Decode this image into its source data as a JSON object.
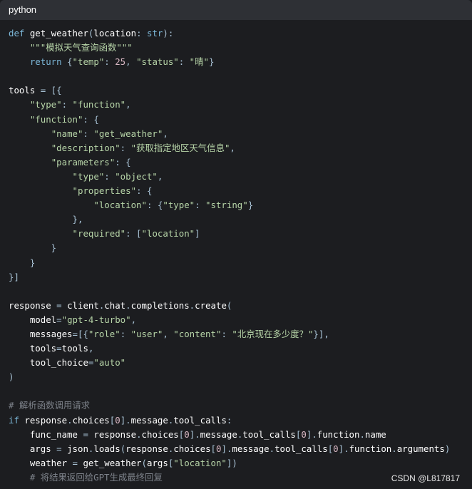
{
  "header": {
    "language": "python"
  },
  "code_lines": [
    [
      [
        "kw",
        "def "
      ],
      [
        "fn",
        "get_weather"
      ],
      [
        "pu",
        "("
      ],
      [
        "fn",
        "location"
      ],
      [
        "pu",
        ": "
      ],
      [
        "kw",
        "str"
      ],
      [
        "pu",
        "):"
      ]
    ],
    [
      [
        "pu",
        "    "
      ],
      [
        "str",
        "\"\"\"模拟天气查询函数\"\"\""
      ]
    ],
    [
      [
        "pu",
        "    "
      ],
      [
        "kw",
        "return "
      ],
      [
        "pu",
        "{"
      ],
      [
        "str",
        "\"temp\""
      ],
      [
        "pu",
        ": "
      ],
      [
        "num",
        "25"
      ],
      [
        "pu",
        ", "
      ],
      [
        "str",
        "\"status\""
      ],
      [
        "pu",
        ": "
      ],
      [
        "str",
        "\"晴\""
      ],
      [
        "pu",
        "}"
      ]
    ],
    [],
    [
      [
        "fn",
        "tools "
      ],
      [
        "pu",
        "= [{"
      ]
    ],
    [
      [
        "pu",
        "    "
      ],
      [
        "str",
        "\"type\""
      ],
      [
        "pu",
        ": "
      ],
      [
        "str",
        "\"function\""
      ],
      [
        "pu",
        ","
      ]
    ],
    [
      [
        "pu",
        "    "
      ],
      [
        "str",
        "\"function\""
      ],
      [
        "pu",
        ": {"
      ]
    ],
    [
      [
        "pu",
        "        "
      ],
      [
        "str",
        "\"name\""
      ],
      [
        "pu",
        ": "
      ],
      [
        "str",
        "\"get_weather\""
      ],
      [
        "pu",
        ","
      ]
    ],
    [
      [
        "pu",
        "        "
      ],
      [
        "str",
        "\"description\""
      ],
      [
        "pu",
        ": "
      ],
      [
        "str",
        "\"获取指定地区天气信息\""
      ],
      [
        "pu",
        ","
      ]
    ],
    [
      [
        "pu",
        "        "
      ],
      [
        "str",
        "\"parameters\""
      ],
      [
        "pu",
        ": {"
      ]
    ],
    [
      [
        "pu",
        "            "
      ],
      [
        "str",
        "\"type\""
      ],
      [
        "pu",
        ": "
      ],
      [
        "str",
        "\"object\""
      ],
      [
        "pu",
        ","
      ]
    ],
    [
      [
        "pu",
        "            "
      ],
      [
        "str",
        "\"properties\""
      ],
      [
        "pu",
        ": {"
      ]
    ],
    [
      [
        "pu",
        "                "
      ],
      [
        "str",
        "\"location\""
      ],
      [
        "pu",
        ": {"
      ],
      [
        "str",
        "\"type\""
      ],
      [
        "pu",
        ": "
      ],
      [
        "str",
        "\"string\""
      ],
      [
        "pu",
        "}"
      ]
    ],
    [
      [
        "pu",
        "            },"
      ]
    ],
    [
      [
        "pu",
        "            "
      ],
      [
        "str",
        "\"required\""
      ],
      [
        "pu",
        ": ["
      ],
      [
        "str",
        "\"location\""
      ],
      [
        "pu",
        "]"
      ]
    ],
    [
      [
        "pu",
        "        }"
      ]
    ],
    [
      [
        "pu",
        "    }"
      ]
    ],
    [
      [
        "pu",
        "}]"
      ]
    ],
    [],
    [
      [
        "fn",
        "response "
      ],
      [
        "pu",
        "= "
      ],
      [
        "fn",
        "client"
      ],
      [
        "pu",
        "."
      ],
      [
        "fn",
        "chat"
      ],
      [
        "pu",
        "."
      ],
      [
        "fn",
        "completions"
      ],
      [
        "pu",
        "."
      ],
      [
        "fn",
        "create"
      ],
      [
        "pu",
        "("
      ]
    ],
    [
      [
        "pu",
        "    "
      ],
      [
        "fn",
        "model"
      ],
      [
        "pu",
        "="
      ],
      [
        "str",
        "\"gpt-4-turbo\""
      ],
      [
        "pu",
        ","
      ]
    ],
    [
      [
        "pu",
        "    "
      ],
      [
        "fn",
        "messages"
      ],
      [
        "pu",
        "=[{"
      ],
      [
        "str",
        "\"role\""
      ],
      [
        "pu",
        ": "
      ],
      [
        "str",
        "\"user\""
      ],
      [
        "pu",
        ", "
      ],
      [
        "str",
        "\"content\""
      ],
      [
        "pu",
        ": "
      ],
      [
        "str",
        "\"北京现在多少度？\""
      ],
      [
        "pu",
        "}],"
      ]
    ],
    [
      [
        "pu",
        "    "
      ],
      [
        "fn",
        "tools"
      ],
      [
        "pu",
        "="
      ],
      [
        "fn",
        "tools"
      ],
      [
        "pu",
        ","
      ]
    ],
    [
      [
        "pu",
        "    "
      ],
      [
        "fn",
        "tool_choice"
      ],
      [
        "pu",
        "="
      ],
      [
        "str",
        "\"auto\""
      ]
    ],
    [
      [
        "pu",
        ")"
      ]
    ],
    [],
    [
      [
        "cm",
        "# 解析函数调用请求"
      ]
    ],
    [
      [
        "kw",
        "if "
      ],
      [
        "fn",
        "response"
      ],
      [
        "pu",
        "."
      ],
      [
        "fn",
        "choices"
      ],
      [
        "pu",
        "["
      ],
      [
        "num",
        "0"
      ],
      [
        "pu",
        "]."
      ],
      [
        "fn",
        "message"
      ],
      [
        "pu",
        "."
      ],
      [
        "fn",
        "tool_calls"
      ],
      [
        "pu",
        ":"
      ]
    ],
    [
      [
        "pu",
        "    "
      ],
      [
        "fn",
        "func_name "
      ],
      [
        "pu",
        "= "
      ],
      [
        "fn",
        "response"
      ],
      [
        "pu",
        "."
      ],
      [
        "fn",
        "choices"
      ],
      [
        "pu",
        "["
      ],
      [
        "num",
        "0"
      ],
      [
        "pu",
        "]."
      ],
      [
        "fn",
        "message"
      ],
      [
        "pu",
        "."
      ],
      [
        "fn",
        "tool_calls"
      ],
      [
        "pu",
        "["
      ],
      [
        "num",
        "0"
      ],
      [
        "pu",
        "]."
      ],
      [
        "fn",
        "function"
      ],
      [
        "pu",
        "."
      ],
      [
        "fn",
        "name"
      ]
    ],
    [
      [
        "pu",
        "    "
      ],
      [
        "fn",
        "args "
      ],
      [
        "pu",
        "= "
      ],
      [
        "fn",
        "json"
      ],
      [
        "pu",
        "."
      ],
      [
        "fn",
        "loads"
      ],
      [
        "pu",
        "("
      ],
      [
        "fn",
        "response"
      ],
      [
        "pu",
        "."
      ],
      [
        "fn",
        "choices"
      ],
      [
        "pu",
        "["
      ],
      [
        "num",
        "0"
      ],
      [
        "pu",
        "]."
      ],
      [
        "fn",
        "message"
      ],
      [
        "pu",
        "."
      ],
      [
        "fn",
        "tool_calls"
      ],
      [
        "pu",
        "["
      ],
      [
        "num",
        "0"
      ],
      [
        "pu",
        "]."
      ],
      [
        "fn",
        "function"
      ],
      [
        "pu",
        "."
      ],
      [
        "fn",
        "arguments"
      ],
      [
        "pu",
        ")"
      ]
    ],
    [
      [
        "pu",
        "    "
      ],
      [
        "fn",
        "weather "
      ],
      [
        "pu",
        "= "
      ],
      [
        "fn",
        "get_weather"
      ],
      [
        "pu",
        "("
      ],
      [
        "fn",
        "args"
      ],
      [
        "pu",
        "["
      ],
      [
        "str",
        "\"location\""
      ],
      [
        "pu",
        "])"
      ]
    ],
    [
      [
        "pu",
        "    "
      ],
      [
        "cm",
        "# 将结果返回给GPT生成最终回复"
      ]
    ]
  ],
  "watermark": "CSDN @L817817",
  "colors": {
    "background": "#1c1d20",
    "header": "#2e3035",
    "keyword": "#7cb7d8",
    "string": "#b7d5a8",
    "number": "#d9b8c4",
    "comment": "#7d828a"
  }
}
